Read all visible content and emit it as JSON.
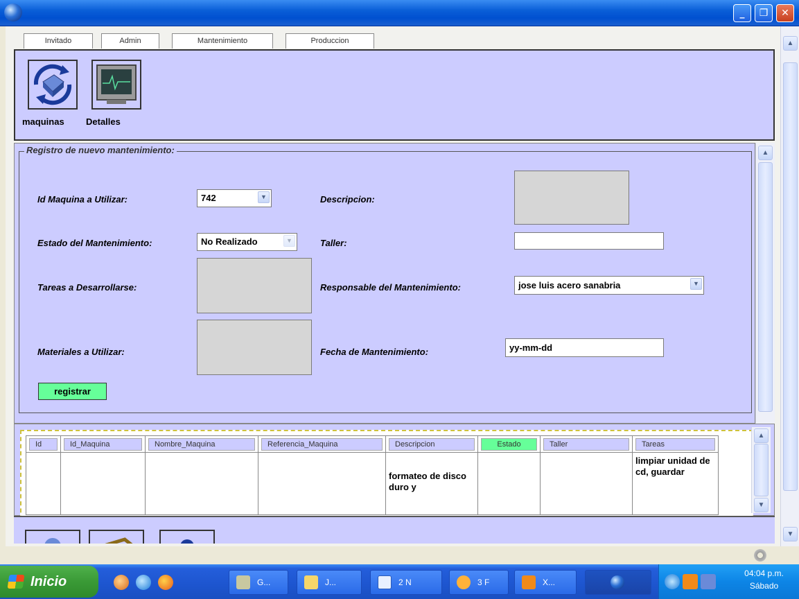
{
  "window": {
    "controls": {
      "minimize": "_",
      "maximize": "❐",
      "close": "✕"
    }
  },
  "tabs": [
    "Invitado",
    "Admin",
    "Mantenimiento",
    "Produccion"
  ],
  "icon_panel": {
    "items": [
      {
        "label": "maquinas",
        "icon": "machines-icon"
      },
      {
        "label": "Detalles",
        "icon": "monitor-icon"
      }
    ]
  },
  "form": {
    "legend": "Registro de nuevo mantenimiento:",
    "labels": {
      "id_maquina": "Id Maquina a Utilizar:",
      "estado": "Estado del Mantenimiento:",
      "tareas": "Tareas a Desarrollarse:",
      "materiales": "Materiales a Utilizar:",
      "descripcion": "Descripcion:",
      "taller": "Taller:",
      "responsable": "Responsable del Mantenimiento:",
      "fecha": "Fecha de Mantenimiento:"
    },
    "values": {
      "id_maquina": "742",
      "estado": "No Realizado",
      "taller": "",
      "responsable": "jose luis acero sanabria",
      "fecha": "yy-mm-dd"
    },
    "submit_label": "registrar"
  },
  "table": {
    "columns": [
      "Id",
      "Id_Maquina",
      "Nombre_Maquina",
      "Referencia_Maquina",
      "Descripcion",
      "Estado",
      "Taller",
      "Tareas"
    ],
    "row": {
      "id": "",
      "id_maquina": "",
      "nombre": "",
      "referencia": "",
      "descripcion": "formateo de disco duro y",
      "estado": "",
      "taller": "",
      "tareas": "limpiar unidad de cd, guardar"
    }
  },
  "taskbar": {
    "start_label": "Inicio",
    "buttons": [
      "G...",
      "J...",
      "2 N",
      "3 F",
      "X..."
    ],
    "clock_time": "04:04 p.m.",
    "clock_day": "Sábado"
  },
  "colors": {
    "panel": "#ccccff",
    "button_green": "#66ff99",
    "titlebar": "#0a5fd8"
  }
}
